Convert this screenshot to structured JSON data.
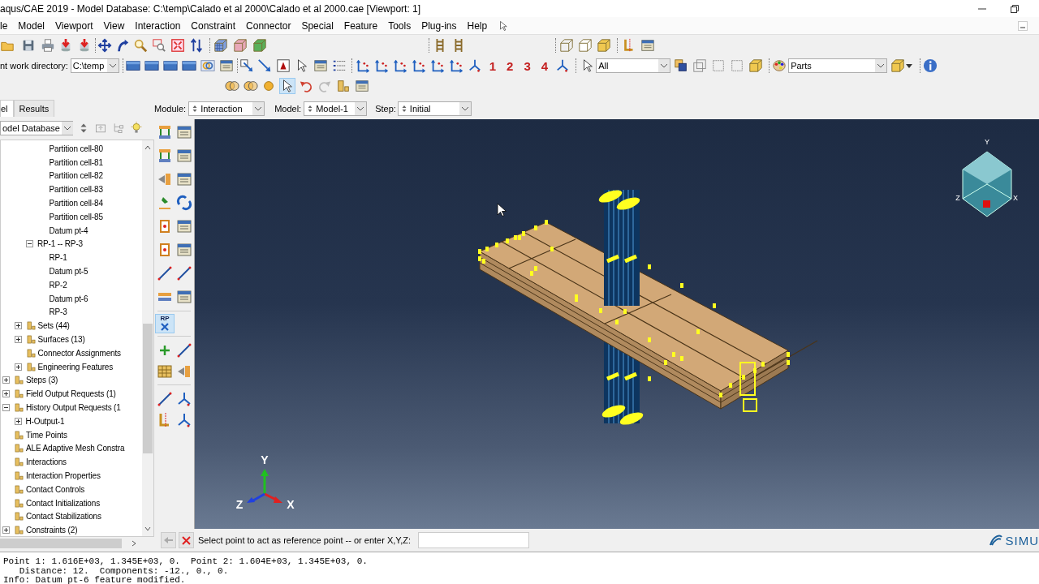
{
  "window": {
    "title": "aqus/CAE 2019 - Model Database: C:\\temp\\Calado et al 2000\\Calado et al 2000.cae [Viewport: 1]"
  },
  "menu": [
    "le",
    "Model",
    "Viewport",
    "View",
    "Interaction",
    "Constraint",
    "Connector",
    "Special",
    "Feature",
    "Tools",
    "Plug-ins",
    "Help"
  ],
  "toolbar": {
    "work_directory": {
      "label": "nt work directory:",
      "value": "C:\\temp"
    },
    "view_buttons": [
      "1",
      "2",
      "3",
      "4"
    ],
    "selection_filter": "All",
    "color_code": "Parts"
  },
  "context_bar": {
    "module": {
      "label": "Module:",
      "value": "Interaction"
    },
    "model": {
      "label": "Model:",
      "value": "Model-1"
    },
    "step": {
      "label": "Step:",
      "value": "Initial"
    }
  },
  "tabs": [
    {
      "label": "el",
      "selected": true
    },
    {
      "label": "Results",
      "selected": false
    }
  ],
  "tree": {
    "root": "odel Database",
    "items": [
      {
        "kind": "continuation",
        "children": [
          {
            "kind": "continuation",
            "children": [
              {
                "kind": "continuation",
                "children": [
                  {
                    "kind": "feature",
                    "label": "Partition cell-80"
                  },
                  {
                    "kind": "feature",
                    "label": "Partition cell-81"
                  },
                  {
                    "kind": "feature",
                    "label": "Partition cell-82"
                  },
                  {
                    "kind": "feature",
                    "label": "Partition cell-83"
                  },
                  {
                    "kind": "feature",
                    "label": "Partition cell-84"
                  },
                  {
                    "kind": "feature",
                    "label": "Partition cell-85"
                  },
                  {
                    "kind": "feature",
                    "label": "Datum pt-4"
                  }
                ]
              },
              {
                "kind": "feature",
                "label": "RP-1 -- RP-3",
                "expanded": true,
                "children": [
                  {
                    "kind": "feature",
                    "label": "RP-1"
                  },
                  {
                    "kind": "feature",
                    "label": "Datum pt-5"
                  },
                  {
                    "kind": "feature",
                    "label": "RP-2"
                  },
                  {
                    "kind": "feature",
                    "label": "Datum pt-6"
                  },
                  {
                    "kind": "feature",
                    "label": "RP-3"
                  }
                ]
              }
            ]
          },
          {
            "kind": "category",
            "label": "Sets (44)",
            "expanded": false
          },
          {
            "kind": "category",
            "label": "Surfaces (13)",
            "expanded": false
          },
          {
            "kind": "category",
            "label": "Connector Assignments"
          },
          {
            "kind": "category",
            "label": "Engineering Features",
            "expanded": false
          }
        ]
      },
      {
        "kind": "category",
        "label": "Steps (3)",
        "expanded": false
      },
      {
        "kind": "category",
        "label": "Field Output Requests (1)",
        "expanded": false
      },
      {
        "kind": "category",
        "label": "History Output Requests (1",
        "expanded": true,
        "children": [
          {
            "kind": "feature",
            "label": "H-Output-1",
            "expanded": false
          }
        ]
      },
      {
        "kind": "category",
        "label": "Time Points"
      },
      {
        "kind": "category",
        "label": "ALE Adaptive Mesh Constra"
      },
      {
        "kind": "category",
        "label": "Interactions"
      },
      {
        "kind": "category",
        "label": "Interaction Properties"
      },
      {
        "kind": "category",
        "label": "Contact Controls"
      },
      {
        "kind": "category",
        "label": "Contact Initializations"
      },
      {
        "kind": "category",
        "label": "Contact Stabilizations"
      },
      {
        "kind": "category",
        "label": "Constraints (2)",
        "expanded": false
      }
    ]
  },
  "toolbox": {
    "reference_point_tool": {
      "label": "RP",
      "selected": true
    }
  },
  "viewport": {
    "triad": {
      "y": "Y",
      "z": "Z",
      "x": "X"
    },
    "view_cube": {
      "y": "Y",
      "z": "Z",
      "x": "X"
    }
  },
  "prompt": {
    "text": "Select point to act as reference point -- or enter X,Y,Z:"
  },
  "brand": "SIMU",
  "messages": [
    "Point 1: 1.616E+03, 1.345E+03, 0.  Point 2: 1.604E+03, 1.345E+03, 0.",
    "   Distance: 12.  Components: -12., 0., 0.",
    "Info: Datum pt-6 feature modified."
  ]
}
